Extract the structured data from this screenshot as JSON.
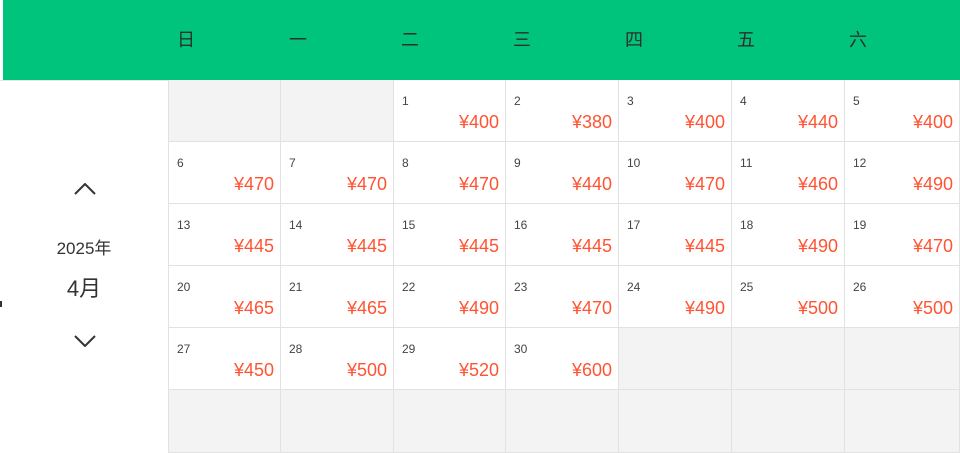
{
  "weekdays": [
    "日",
    "一",
    "二",
    "三",
    "四",
    "五",
    "六"
  ],
  "nav": {
    "year_label": "2025年",
    "month_label": "4月"
  },
  "colors": {
    "header_bg": "#00c47b",
    "price": "#ff5433",
    "empty_cell": "#f3f3f3"
  },
  "icons": {
    "prev": "chevron-up-icon",
    "next": "chevron-down-icon"
  },
  "calendar": {
    "leading_blanks": 2,
    "total_cells": 42,
    "days": [
      {
        "day": "1",
        "price": "¥400"
      },
      {
        "day": "2",
        "price": "¥380"
      },
      {
        "day": "3",
        "price": "¥400"
      },
      {
        "day": "4",
        "price": "¥440"
      },
      {
        "day": "5",
        "price": "¥400"
      },
      {
        "day": "6",
        "price": "¥470"
      },
      {
        "day": "7",
        "price": "¥470"
      },
      {
        "day": "8",
        "price": "¥470"
      },
      {
        "day": "9",
        "price": "¥440"
      },
      {
        "day": "10",
        "price": "¥470"
      },
      {
        "day": "11",
        "price": "¥460"
      },
      {
        "day": "12",
        "price": "¥490"
      },
      {
        "day": "13",
        "price": "¥445"
      },
      {
        "day": "14",
        "price": "¥445"
      },
      {
        "day": "15",
        "price": "¥445"
      },
      {
        "day": "16",
        "price": "¥445"
      },
      {
        "day": "17",
        "price": "¥445"
      },
      {
        "day": "18",
        "price": "¥490"
      },
      {
        "day": "19",
        "price": "¥470"
      },
      {
        "day": "20",
        "price": "¥465"
      },
      {
        "day": "21",
        "price": "¥465"
      },
      {
        "day": "22",
        "price": "¥490"
      },
      {
        "day": "23",
        "price": "¥470"
      },
      {
        "day": "24",
        "price": "¥490"
      },
      {
        "day": "25",
        "price": "¥500"
      },
      {
        "day": "26",
        "price": "¥500"
      },
      {
        "day": "27",
        "price": "¥450"
      },
      {
        "day": "28",
        "price": "¥500"
      },
      {
        "day": "29",
        "price": "¥520"
      },
      {
        "day": "30",
        "price": "¥600"
      }
    ]
  }
}
